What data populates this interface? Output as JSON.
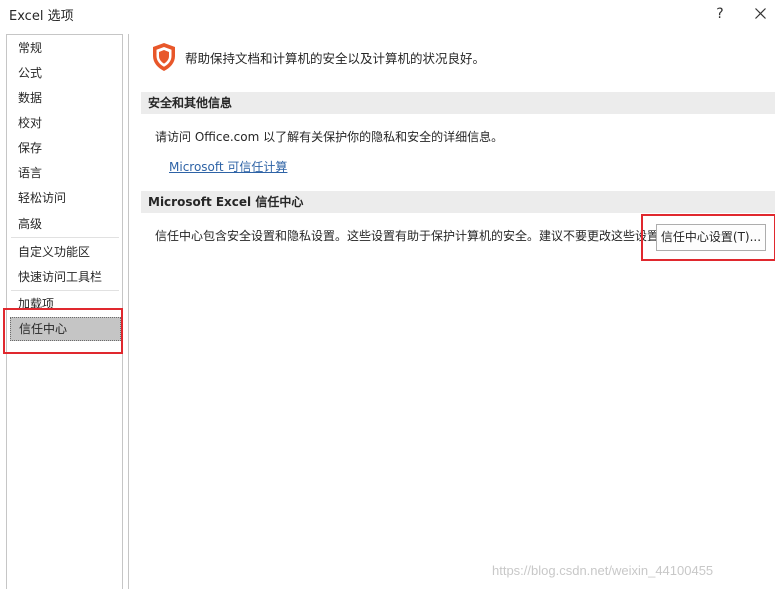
{
  "window": {
    "title": "Excel 选项",
    "help_label": "?",
    "close_icon": "close-icon"
  },
  "sidebar": {
    "items": [
      {
        "label": "常规"
      },
      {
        "label": "公式"
      },
      {
        "label": "数据"
      },
      {
        "label": "校对"
      },
      {
        "label": "保存"
      },
      {
        "label": "语言"
      },
      {
        "label": "轻松访问"
      },
      {
        "label": "高级"
      },
      {
        "label": "自定义功能区"
      },
      {
        "label": "快速访问工具栏"
      },
      {
        "label": "加载项"
      },
      {
        "label": "信任中心",
        "selected": true
      }
    ]
  },
  "main": {
    "intro_icon": "shield-icon",
    "intro_text": "帮助保持文档和计算机的安全以及计算机的状况良好。",
    "privacy_section": {
      "header": "安全和其他信息",
      "text": "请访问 Office.com  以了解有关保护你的隐私和安全的详细信息。",
      "link": "Microsoft 可信任计算"
    },
    "trust_center_section": {
      "header": "Microsoft Excel 信任中心",
      "text": "信任中心包含安全设置和隐私设置。这些设置有助于保护计算机的安全。建议不要更改这些设置。",
      "button_label": "信任中心设置(T)..."
    }
  },
  "watermark": "https://blog.csdn.net/weixin_44100455",
  "colors": {
    "highlight_red": "#e0282e",
    "shield_orange": "#e8572a",
    "link_blue": "#2e63a6",
    "selected_bg": "#c5c5c5"
  }
}
